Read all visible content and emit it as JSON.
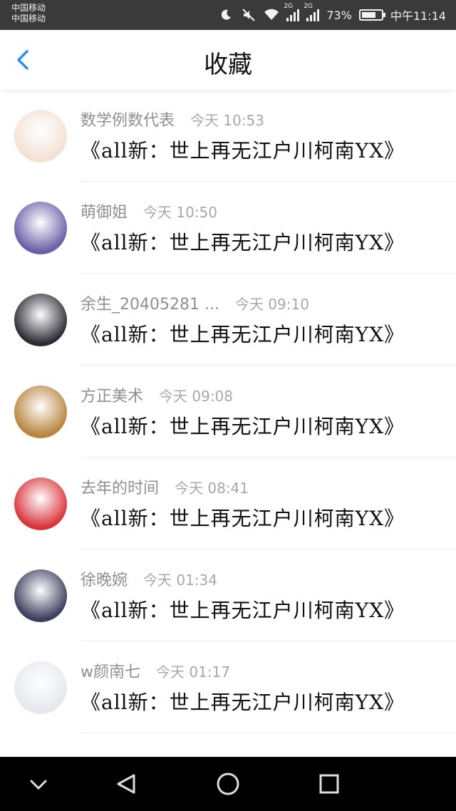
{
  "status_bar": {
    "carrier_1": "中国移动",
    "carrier_2": "中国移动",
    "network_1": "2G",
    "network_2": "2G",
    "battery": "73%",
    "battery_level": 0.73,
    "time": "中午11:14",
    "icons": [
      "moon-icon",
      "mute-icon",
      "wifi-icon",
      "signal-icon",
      "battery-icon"
    ]
  },
  "header": {
    "title": "收藏",
    "back_icon": "chevron-left-icon",
    "accent": "#2b8ff0"
  },
  "list": [
    {
      "author": "数学例数代表",
      "time": "今天 10:53",
      "title": "《all新：世上再无江户川柯南YX》",
      "avatar_color": "#f2e2d6"
    },
    {
      "author": "萌御姐",
      "time": "今天 10:50",
      "title": "《all新：世上再无江户川柯南YX》",
      "avatar_color": "#6b5fa8"
    },
    {
      "author": "余生_20405281 ...",
      "time": "今天 09:10",
      "title": "《all新：世上再无江户川柯南YX》",
      "avatar_color": "#2b2b34"
    },
    {
      "author": "方正美术",
      "time": "今天 09:08",
      "title": "《all新：世上再无江户川柯南YX》",
      "avatar_color": "#b8853f"
    },
    {
      "author": "去年的时间",
      "time": "今天 08:41",
      "title": "《all新：世上再无江户川柯南YX》",
      "avatar_color": "#d9343a"
    },
    {
      "author": "徐晚婉",
      "time": "今天 01:34",
      "title": "《all新：世上再无江户川柯南YX》",
      "avatar_color": "#3c3f5e"
    },
    {
      "author": "w颜南七",
      "time": "今天 01:17",
      "title": "《all新：世上再无江户川柯南YX》",
      "avatar_color": "#e6e8ee"
    }
  ],
  "nav_bar": {
    "icons": [
      "chevron-down-icon",
      "back-triangle-icon",
      "home-circle-icon",
      "recents-square-icon"
    ]
  }
}
